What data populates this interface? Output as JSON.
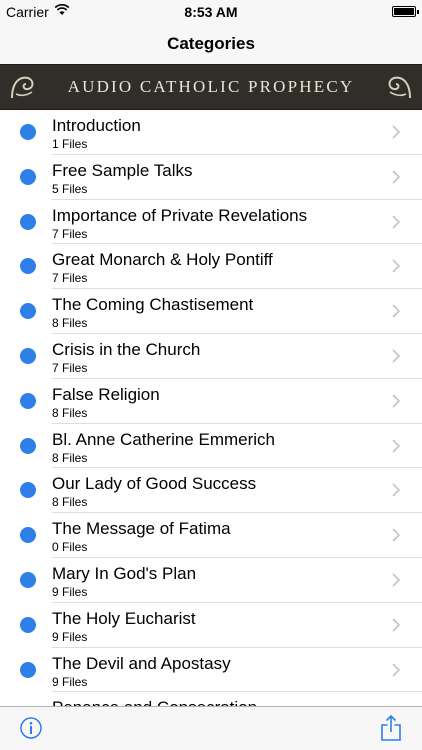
{
  "status": {
    "carrier": "Carrier",
    "time": "8:53 AM",
    "battery_level": 1.0
  },
  "nav": {
    "title": "Categories"
  },
  "banner": {
    "text": "AUDIO CATHOLIC PROPHECY"
  },
  "accent_color": "#2f7fe8",
  "rows": [
    {
      "title": "Introduction",
      "sub": "1 Files"
    },
    {
      "title": "Free Sample Talks",
      "sub": "5 Files"
    },
    {
      "title": "Importance of Private Revelations",
      "sub": "7 Files"
    },
    {
      "title": "Great Monarch & Holy Pontiff",
      "sub": "7 Files"
    },
    {
      "title": "The Coming Chastisement",
      "sub": "8 Files"
    },
    {
      "title": "Crisis in the Church",
      "sub": "7 Files"
    },
    {
      "title": "False Religion",
      "sub": "8 Files"
    },
    {
      "title": "Bl. Anne Catherine Emmerich",
      "sub": "8 Files"
    },
    {
      "title": "Our Lady of Good Success",
      "sub": "8 Files"
    },
    {
      "title": "The Message of Fatima",
      "sub": "0 Files"
    },
    {
      "title": "Mary In God's Plan",
      "sub": "9 Files"
    },
    {
      "title": "The Holy Eucharist",
      "sub": "9 Files"
    },
    {
      "title": "The Devil and Apostasy",
      "sub": "9 Files"
    },
    {
      "title": "Penance and Consecration",
      "sub": ""
    }
  ],
  "toolbar": {
    "left_icon": "info-icon",
    "right_icon": "share-icon"
  }
}
